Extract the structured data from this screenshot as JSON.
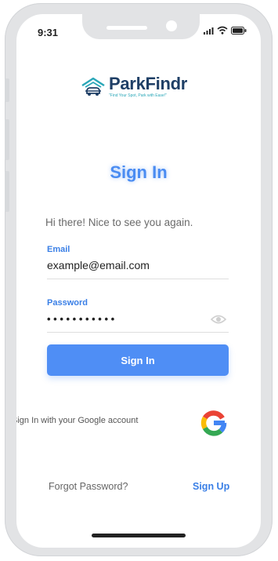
{
  "status_bar": {
    "time": "9:31"
  },
  "brand": {
    "name": "ParkFindr",
    "tagline": "\"Find Your Spot, Park with Ease!\""
  },
  "page": {
    "title": "Sign In",
    "greeting": "Hi there! Nice to see you again."
  },
  "email": {
    "label": "Email",
    "value": "example@email.com"
  },
  "password": {
    "label": "Password",
    "value": "• • • • • • • • • • •"
  },
  "actions": {
    "sign_in": "Sign In",
    "google_text": "Sign In with your Google account",
    "forgot_password": "Forgot Password?",
    "sign_up": "Sign Up"
  },
  "colors": {
    "accent": "#4f8ef5",
    "brand_dark": "#1f3f66",
    "brand_teal": "#2aa7b8"
  },
  "icons": [
    "signal-icon",
    "wifi-icon",
    "battery-icon",
    "car-garage-icon",
    "eye-icon",
    "google-icon"
  ]
}
